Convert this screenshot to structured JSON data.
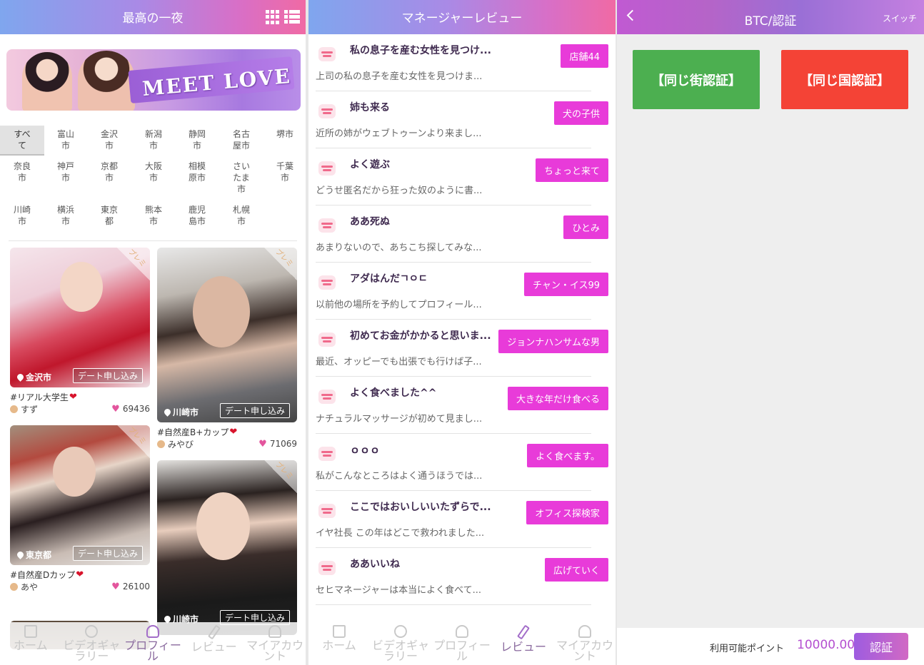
{
  "home": {
    "title": "最高の一夜",
    "banner_text": "MEET LOVE",
    "cities": [
      "すべて",
      "富山市",
      "金沢市",
      "新潟市",
      "静岡市",
      "名古屋市",
      "堺市",
      "奈良市",
      "神戸市",
      "京都市",
      "大阪市",
      "相模原市",
      "さいたま市",
      "千葉市",
      "川崎市",
      "横浜市",
      "東京都",
      "熊本市",
      "鹿児島市",
      "札幌市"
    ],
    "city_display": [
      "すべ\nて",
      "富山\n市",
      "金沢\n市",
      "新潟\n市",
      "静岡\n市",
      "名古\n屋市",
      "堺市",
      "奈良\n市",
      "神戸\n市",
      "京都\n市",
      "大阪\n市",
      "相模\n原市",
      "さい\nたま\n市",
      "千葉\n市",
      "川崎\n市",
      "横浜\n市",
      "東京\n都",
      "熊本\n市",
      "鹿児\n島市",
      "札幌\n市"
    ],
    "corner_label": "プレミ",
    "date_button": "デート申し込み",
    "profiles": [
      {
        "location": "金沢市",
        "tag": "#リアル大学生",
        "name": "すず",
        "likes": "69436"
      },
      {
        "location": "川崎市",
        "tag": "#自然産B+カップ",
        "name": "みやび",
        "likes": "71069"
      },
      {
        "location": "東京都",
        "tag": "#自然産Dカップ",
        "name": "あや",
        "likes": "26100"
      },
      {
        "location": "川崎市",
        "tag": "",
        "name": "",
        "likes": ""
      }
    ]
  },
  "reviews": {
    "title": "マネージャーレビュー",
    "items": [
      {
        "title": "私の息子を産む女性を見つけ...",
        "body": "上司の私の息子を産む女性を見つけま...",
        "tag": "店舗44"
      },
      {
        "title": "姉も来る",
        "body": "近所の姉がウェブトゥーンより来まし...",
        "tag": "犬の子供"
      },
      {
        "title": "よく遊ぶ",
        "body": "どうせ匿名だから狂った奴のように書...",
        "tag": "ちょっと来て"
      },
      {
        "title": "ああ死ぬ",
        "body": "あまりないので、あちこち探してみな...",
        "tag": "ひとみ"
      },
      {
        "title": "アダはんだㄱㅇㄷ",
        "body": "以前他の場所を予約してプロフィール...",
        "tag": "チャン・イス99"
      },
      {
        "title": "初めてお金がかかると思いま...",
        "body": "最近、オッピーでも出張でも行けば子...",
        "tag": "ジョンナハンサムな男"
      },
      {
        "title": "よく食べました^^",
        "body": "ナチュラルマッサージが初めて見まし...",
        "tag": "大きな年だけ食べる"
      },
      {
        "title": "ｏｏｏ",
        "body": "私がこんなところはよく通うほうでは...",
        "tag": "よく食べます。"
      },
      {
        "title": "ここではおいしいいたずらで...",
        "body": "イヤ社長 この年はどこで救われました...",
        "tag": "オフィス探検家"
      },
      {
        "title": "ああいいね",
        "body": "セヒマネージャーは本当によく食べて...",
        "tag": "広げていく"
      }
    ]
  },
  "nav": {
    "items": [
      {
        "label": "ホーム",
        "icon": "home-icon"
      },
      {
        "label": "ビデオギャラリー",
        "icon": "video-icon"
      },
      {
        "label": "プロフィール",
        "icon": "profile-icon"
      },
      {
        "label": "レビュー",
        "icon": "review-icon"
      },
      {
        "label": "マイアカウント",
        "icon": "account-icon"
      }
    ],
    "labels_display": [
      "ホーム",
      "ビデオギャ\nラリー",
      "プロフィー\nル",
      "レビュー",
      "マイアカウ\nント"
    ]
  },
  "verify": {
    "title": "BTC/認証",
    "switch_label": "スイッチ",
    "street_button": "【同じ街認証】",
    "country_button": "【同じ国認証】",
    "points_label": "利用可能ポイント",
    "points_value": "10000.00",
    "submit_button": "認証"
  },
  "colors": {
    "accent_pink": "#e83bd9",
    "green": "#4caf50",
    "red": "#f44336",
    "points_purple": "#b44fd0"
  }
}
